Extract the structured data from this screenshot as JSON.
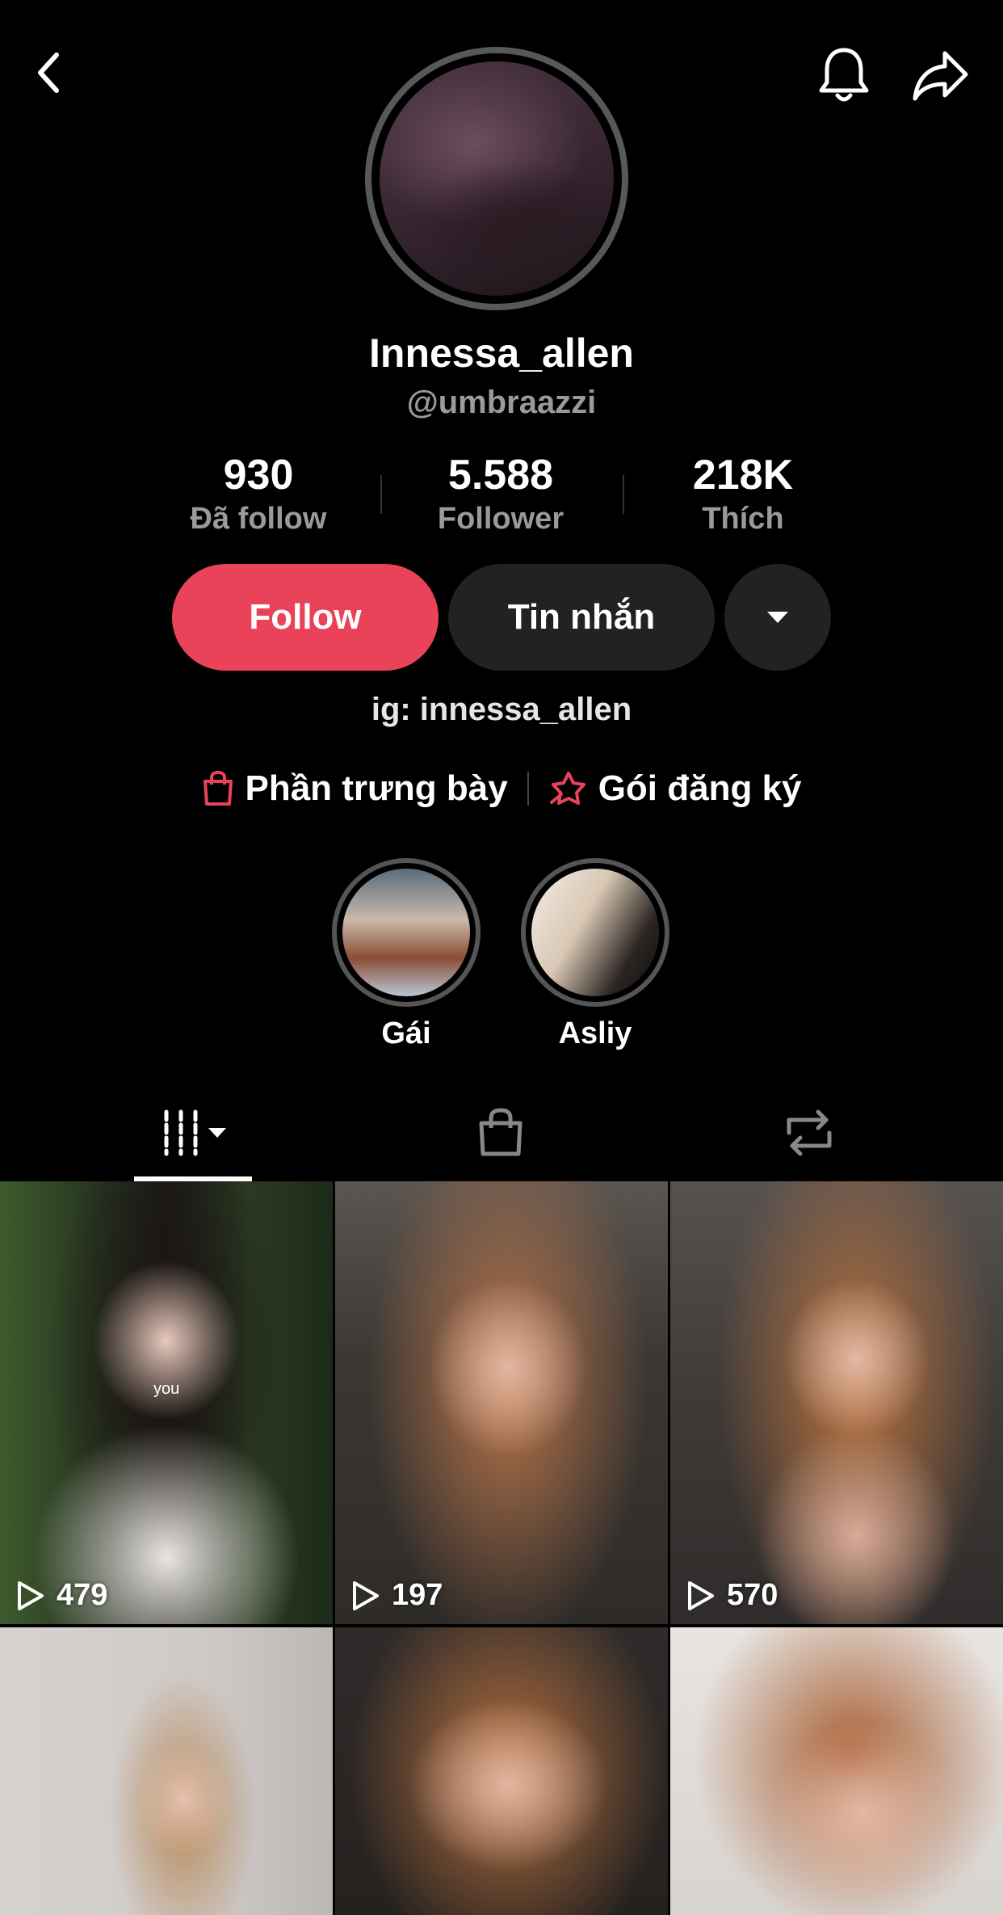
{
  "profile": {
    "display_name": "Innessa_allen",
    "username": "@umbraazzi",
    "bio": "ig: innessa_allen"
  },
  "stats": {
    "following": {
      "value": "930",
      "label": "Đã follow"
    },
    "followers": {
      "value": "5.588",
      "label": "Follower"
    },
    "likes": {
      "value": "218K",
      "label": "Thích"
    }
  },
  "actions": {
    "follow_label": "Follow",
    "message_label": "Tin nhắn"
  },
  "links": {
    "showcase_label": "Phần trưng bày",
    "subscription_label": "Gói đăng ký"
  },
  "highlights": [
    {
      "name": "Gái"
    },
    {
      "name": "Asliy"
    }
  ],
  "videos": [
    {
      "views": "479",
      "caption": "you"
    },
    {
      "views": "197"
    },
    {
      "views": "570"
    },
    {},
    {},
    {}
  ],
  "colors": {
    "follow_button": "#ea4359",
    "secondary_button": "#222222",
    "background": "#000000",
    "muted_text": "#9a9a9a"
  },
  "icons": {
    "back": "chevron-left-icon",
    "notifications": "bell-icon",
    "share": "share-arrow-icon",
    "more": "caret-down-icon",
    "showcase": "shopping-bag-icon",
    "subscription": "star-badge-icon",
    "videos_tab": "grid-columns-icon",
    "shop_tab": "shopping-bag-icon",
    "reposts_tab": "repost-icon",
    "play": "play-icon"
  }
}
